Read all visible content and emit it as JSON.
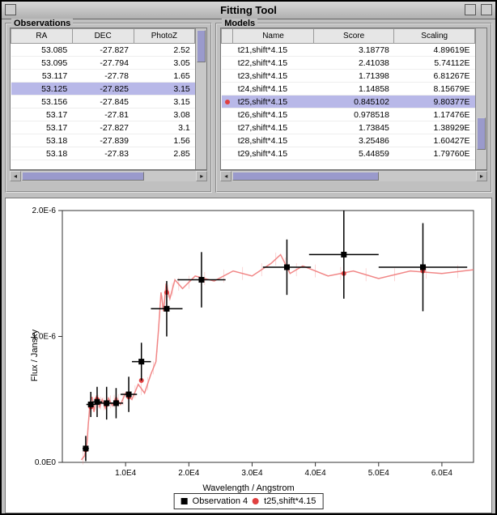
{
  "window": {
    "title": "Fitting Tool"
  },
  "observations": {
    "legend": "Observations",
    "columns": [
      "RA",
      "DEC",
      "PhotoZ"
    ],
    "selected_index": 3,
    "rows": [
      {
        "ra": "53.085",
        "dec": "-27.827",
        "photoz": "2.52"
      },
      {
        "ra": "53.095",
        "dec": "-27.794",
        "photoz": "3.05"
      },
      {
        "ra": "53.117",
        "dec": "-27.78",
        "photoz": "1.65"
      },
      {
        "ra": "53.125",
        "dec": "-27.825",
        "photoz": "3.15"
      },
      {
        "ra": "53.156",
        "dec": "-27.845",
        "photoz": "3.15"
      },
      {
        "ra": "53.17",
        "dec": "-27.81",
        "photoz": "3.08"
      },
      {
        "ra": "53.17",
        "dec": "-27.827",
        "photoz": "3.1"
      },
      {
        "ra": "53.18",
        "dec": "-27.839",
        "photoz": "1.56"
      },
      {
        "ra": "53.18",
        "dec": "-27.83",
        "photoz": "2.85"
      }
    ]
  },
  "models": {
    "legend": "Models",
    "columns": [
      "Name",
      "Score",
      "Scaling"
    ],
    "selected_index": 4,
    "rows": [
      {
        "name": "t21,shift*4.15",
        "score": "3.18778",
        "scaling": "4.89619E"
      },
      {
        "name": "t22,shift*4.15",
        "score": "2.41038",
        "scaling": "5.74112E"
      },
      {
        "name": "t23,shift*4.15",
        "score": "1.71398",
        "scaling": "6.81267E"
      },
      {
        "name": "t24,shift*4.15",
        "score": "1.14858",
        "scaling": "8.15679E"
      },
      {
        "name": "t25,shift*4.15",
        "score": "0.845102",
        "scaling": "9.80377E"
      },
      {
        "name": "t26,shift*4.15",
        "score": "0.978518",
        "scaling": "1.17476E"
      },
      {
        "name": "t27,shift*4.15",
        "score": "1.73845",
        "scaling": "1.38929E"
      },
      {
        "name": "t28,shift*4.15",
        "score": "3.25486",
        "scaling": "1.60427E"
      },
      {
        "name": "t29,shift*4.15",
        "score": "5.44859",
        "scaling": "1.79760E"
      }
    ]
  },
  "chart_data": {
    "type": "scatter",
    "title": "",
    "xlabel": "Wavelength / Angstrom",
    "ylabel": "Flux / Jansky",
    "xlim": [
      0,
      65000
    ],
    "ylim": [
      0,
      2e-06
    ],
    "xticks": [
      10000,
      20000,
      30000,
      40000,
      50000,
      60000
    ],
    "xticklabels": [
      "1.0E4",
      "2.0E4",
      "3.0E4",
      "4.0E4",
      "5.0E4",
      "6.0E4"
    ],
    "yticks": [
      0,
      1e-06,
      2e-06
    ],
    "yticklabels": [
      "0.0E0",
      "1.0E-6",
      "2.0E-6"
    ],
    "legend": [
      {
        "marker": "square",
        "color": "#000000",
        "label": "Observation 4"
      },
      {
        "marker": "circle",
        "color": "#e04040",
        "label": "t25,shift*4.15"
      }
    ],
    "series": [
      {
        "name": "Observation 4",
        "type": "scatter-error",
        "color": "#000000",
        "points": [
          {
            "x": 3700,
            "y": 1.1e-07,
            "ex": 500,
            "ey": 1e-07
          },
          {
            "x": 4500,
            "y": 4.6e-07,
            "ex": 700,
            "ey": 1e-07
          },
          {
            "x": 5500,
            "y": 4.8e-07,
            "ex": 800,
            "ey": 1.2e-07
          },
          {
            "x": 7000,
            "y": 4.7e-07,
            "ex": 1100,
            "ey": 1.3e-07
          },
          {
            "x": 8500,
            "y": 4.7e-07,
            "ex": 1100,
            "ey": 1.2e-07
          },
          {
            "x": 10500,
            "y": 5.4e-07,
            "ex": 1300,
            "ey": 1.4e-07
          },
          {
            "x": 12500,
            "y": 8e-07,
            "ex": 1500,
            "ey": 1.5e-07
          },
          {
            "x": 16500,
            "y": 1.22e-06,
            "ex": 2500,
            "ey": 2.2e-07
          },
          {
            "x": 22000,
            "y": 1.45e-06,
            "ex": 3800,
            "ey": 2.2e-07
          },
          {
            "x": 35500,
            "y": 1.55e-06,
            "ex": 3800,
            "ey": 2.2e-07
          },
          {
            "x": 44500,
            "y": 1.65e-06,
            "ex": 5500,
            "ey": 3.5e-07
          },
          {
            "x": 57000,
            "y": 1.55e-06,
            "ex": 7000,
            "ey": 3.5e-07
          }
        ]
      },
      {
        "name": "t25,shift*4.15",
        "type": "line-points",
        "color": "#f05a5a",
        "points": [
          {
            "x": 3700,
            "y": 1e-07
          },
          {
            "x": 4500,
            "y": 4.4e-07
          },
          {
            "x": 5500,
            "y": 5e-07
          },
          {
            "x": 7000,
            "y": 4.6e-07
          },
          {
            "x": 8500,
            "y": 4.8e-07
          },
          {
            "x": 10500,
            "y": 5.2e-07
          },
          {
            "x": 12500,
            "y": 6.5e-07
          },
          {
            "x": 16500,
            "y": 1.35e-06
          },
          {
            "x": 22000,
            "y": 1.45e-06
          },
          {
            "x": 35500,
            "y": 1.55e-06
          },
          {
            "x": 44500,
            "y": 1.5e-06
          },
          {
            "x": 57000,
            "y": 1.52e-06
          }
        ],
        "spectrum": [
          {
            "x": 3000,
            "y": 2e-08
          },
          {
            "x": 3500,
            "y": 5e-08
          },
          {
            "x": 3900,
            "y": 1.5e-07
          },
          {
            "x": 4100,
            "y": 3e-07
          },
          {
            "x": 4400,
            "y": 4.8e-07
          },
          {
            "x": 4700,
            "y": 5.2e-07
          },
          {
            "x": 5000,
            "y": 4e-07
          },
          {
            "x": 5400,
            "y": 5.3e-07
          },
          {
            "x": 5900,
            "y": 4.4e-07
          },
          {
            "x": 6300,
            "y": 5e-07
          },
          {
            "x": 6800,
            "y": 4.3e-07
          },
          {
            "x": 7300,
            "y": 5.1e-07
          },
          {
            "x": 7900,
            "y": 4.5e-07
          },
          {
            "x": 8500,
            "y": 5.2e-07
          },
          {
            "x": 9200,
            "y": 4.6e-07
          },
          {
            "x": 10000,
            "y": 5.5e-07
          },
          {
            "x": 11000,
            "y": 5e-07
          },
          {
            "x": 12000,
            "y": 6.2e-07
          },
          {
            "x": 13000,
            "y": 5.5e-07
          },
          {
            "x": 14000,
            "y": 7e-07
          },
          {
            "x": 14800,
            "y": 8e-07
          },
          {
            "x": 15200,
            "y": 1.05e-06
          },
          {
            "x": 15600,
            "y": 1.35e-06
          },
          {
            "x": 16000,
            "y": 1.2e-06
          },
          {
            "x": 16400,
            "y": 1.42e-06
          },
          {
            "x": 17000,
            "y": 1.3e-06
          },
          {
            "x": 17800,
            "y": 1.45e-06
          },
          {
            "x": 19000,
            "y": 1.38e-06
          },
          {
            "x": 21000,
            "y": 1.48e-06
          },
          {
            "x": 24000,
            "y": 1.44e-06
          },
          {
            "x": 27000,
            "y": 1.52e-06
          },
          {
            "x": 30000,
            "y": 1.48e-06
          },
          {
            "x": 33000,
            "y": 1.58e-06
          },
          {
            "x": 34500,
            "y": 1.65e-06
          },
          {
            "x": 36000,
            "y": 1.5e-06
          },
          {
            "x": 38000,
            "y": 1.56e-06
          },
          {
            "x": 42000,
            "y": 1.48e-06
          },
          {
            "x": 46000,
            "y": 1.52e-06
          },
          {
            "x": 50000,
            "y": 1.46e-06
          },
          {
            "x": 55000,
            "y": 1.52e-06
          },
          {
            "x": 60000,
            "y": 1.5e-06
          },
          {
            "x": 65000,
            "y": 1.53e-06
          }
        ]
      }
    ]
  }
}
